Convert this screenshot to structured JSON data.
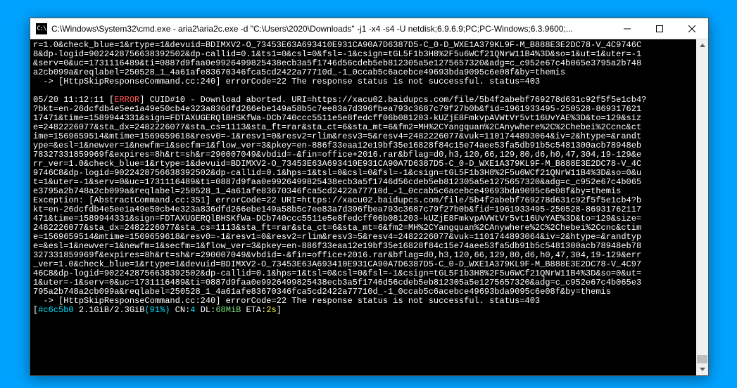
{
  "window": {
    "title": "C:\\Windows\\System32\\cmd.exe - aria2\\aria2c.exe  -d \"C:\\Users\\2020\\Downloads\" -j1 -x4 -s4 -U netdisk;6.9.6.9;PC;PC-Windows;6.3.9600;..."
  },
  "icons": {
    "cmd": "C:\\"
  },
  "lines": {
    "l1": "r=1.0&check_blue=1&rtype=1&devuid=BDIMXV2-O_73453E63A693410E931CA90A7D6387D5-C_0-D_WXE1A379KL9F-M_B888E3E2DC78-V_4C9746C",
    "l2": "8&dp-logid=9022428756638392502&dp-callid=0.1&ts1=0&csl=0&fsl=-1&csign=tGL5F1b3H8%2F5u6WCf21QNrW11B4%3D&so=1&ut=1&uter=-1",
    "l3": "&serv=0&uc=1731116489&ti=0887d9faa0e9926499825438ecb3a5f1746d56cdeb5eb812305a5e1275657320&adg=c_c952e67c4b065e3795a2b748",
    "l4": "a2cb099a&reqlabel=250528_1_4a61afe83670346fca5cd2422a77710d_-1_0ccab5c6acebce49693bda9095c6e08f&by=themis",
    "l5a": "  -> [HttpSkipResponseCommand.cc:240] ",
    "l5b": "errorCode=22 The response status is not successful. status=403",
    "l6": "",
    "l7a": "05/20 11:12:11 [",
    "l7b": "ERROR",
    "l7c": "] CUID#10 - Download aborted. URI=https://xacu02.baidupcs.com/file/5b4f2abebf769278d631c92f5f5e1cb4?",
    "l8": "?bkt=en-26dcfdb4e5ee1a49e50cb4e323a836dfd266ebe149a58b5c7ee83a7d396fbea793c3687c79f27b0b&fid=1961933495-250528-869317621",
    "l9": "17471&time=1589944331&sign=FDTAXUGERQlBHSKfWa-DCb740ccc5511e5e8fedcff06b081203-kUZjE8FmkvpAVWtVr5vt16UvYAE%3D&to=129&siz",
    "l10": "e=2482226077&sta_dx=2482226077&sta_cs=1113&sta_ft=rar&sta_ct=6&sta_mt=6&fm2=MH%2CYangquan%2CAnywhere%2C%2Chebei%2Ccnc&ct",
    "l11": "ime=1569659514&mtime=1569659618&resv0=-1&resv1=0&resv2=rlim&resv3=5&resv4=2482226077&vuk=1101744893064&iv=2&htype=&randt",
    "l12": "ype=&esl=1&newver=1&newfm=1&secfm=1&flow_ver=3&pkey=en-886f33eaa12e19bf35e16828f84c15e74aee53fa5db91b5c5481300acb78948eb",
    "l13": "78327331859969f&expires=8h&rt=sh&r=290007049&vbdid=-&fin=office+2016.rar&bflag=d0,h3,120,66,129,80,d6,h0,47,304,19-129&e",
    "l14": "rr_ver=1.0&check_blue=1&rtype=1&devuid=BDIMXV2-O_73453E63A693410E931CA90A7D6387D5-C_0-D_WXE1A379KL9F-M_B888E3E2DC78-V_4C",
    "l15": "9746C8&dp-logid=9022428756638392502&dp-callid=0.1&hps=1&tsl=0&csl=0&fsl=-1&csign=tGL5F1b3H8%2F5u6WCf21QNrW11B4%3D&so=0&u",
    "l16": "t=1&uter=-1&serv=0&uc=1731116489&ti=0887d9faa0e9926499825438ecb3a5f1746d56cdeb5eb812305a5e1275657320&adg=c_c952e67c4b065",
    "l17": "e3795a2b748a2cb099a&reqlabel=250528_1_4a61afe83670346fca5cd2422a77710d_-1_0ccab5c6acebce49693bda9095c6e08f&by=themis",
    "l18": "Exception: [AbstractCommand.cc:351] errorCode=22 URI=https://xacu02.baidupcs.com/file/5b4f2abebf769278d631c92f5f5e1cb4?b",
    "l19": "kt=en-26dcfdb4e5ee1a49e50cb4e323a836dfd266ebe149a58b5c7ee83a7d396fbea793c3687c79f27b0b&fid=1961933495-250528-86931762117",
    "l20": "471&time=1589944331&sign=FDTAXUGERQlBHSKfWa-DCb740ccc5511e5e8fedcff06b081203-kUZjE8FmkvpAVWtVr5vt16UvYAE%3D&to=129&size=",
    "l21": "2482226077&sta_dx=2482226077&sta_cs=1113&sta_ft=rar&sta_ct=6&sta_mt=6&fm2=MH%2CYangquan%2CAnywhere%2C%2Chebei%2Ccnc&ctim",
    "l22": "e=1569659514&mtime=1569659618&resv0=-1&resv1=0&resv2=rlim&resv3=5&resv4=2482226077&vuk=1101744893064&iv=2&htype=&randtyp",
    "l23": "e=&esl=1&newver=1&newfm=1&secfm=1&flow_ver=3&pkey=en-886f33eaa12e19bf35e16828f84c15e74aee53fa5db91b5c5481300acb78948eb78",
    "l24": "327331859969f&expires=8h&rt=sh&r=290007049&vbdid=-&fin=office+2016.rar&bflag=d0,h3,120,66,129,80,d6,h0,47,304,19-129&err",
    "l25": "_ver=1.0&check_blue=1&rtype=1&devuid=BDIMXV2-O_73453E63A693410E931CA90A7D6387D5-C_0-D_WXE1A379KL9F-M_B888E3E2DC78-V_4C97",
    "l26": "46C8&dp-logid=9022428756638392502&dp-callid=0.1&hps=1&tsl=0&csl=0&fsl=-1&csign=tGL5F1b3H8%2F5u6WCf21QNrW11B4%3D&so=0&ut=",
    "l27": "1&uter=-1&serv=0&uc=1731116489&ti=0887d9faa0e9926499825438ecb3a5f1746d56cdeb5eb812305a5e1275657320&adg=c_c952e67c4b065e3",
    "l28": "795a2b748a2cb099a&reqlabel=250528_1_4a61afe83670346fca5cd2422a77710d_-1_0ccab5c6acebce49693bda9095c6e08f&by=themis",
    "l29a": "  -> [HttpSkipResponseCommand.cc:240] ",
    "l29b": "errorCode=22 The response status is not successful. status=403",
    "status_open": "[",
    "status_hash": "#c6c5b0",
    "status_size": " 2.1GiB",
    "status_total": "/2.3GiB",
    "status_pct_open": "(",
    "status_pct": "91%",
    "status_pct_close": ")",
    "status_cn_lbl": " CN:",
    "status_cn_val": "4",
    "status_dl_lbl": " DL:",
    "status_dl_val": "68MiB",
    "status_eta_lbl": " ETA:",
    "status_eta_val": "2s",
    "status_close": "]"
  }
}
